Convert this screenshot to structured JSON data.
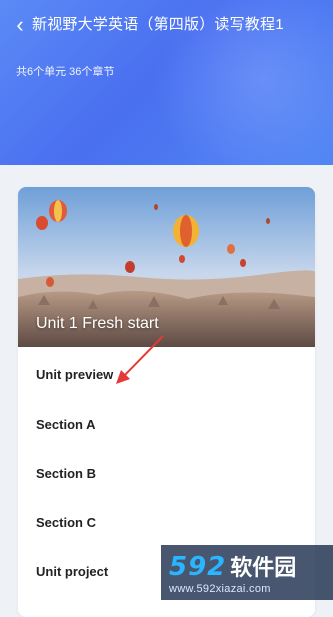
{
  "header": {
    "back_icon": "chevron-left-icon",
    "title": "新视野大学英语（第四版）读写教程1",
    "meta": "共6个单元 36个章节"
  },
  "unit": {
    "title": "Unit 1 Fresh start",
    "banner_image": "hot-air-balloons-landscape",
    "sections": [
      "Unit preview",
      "Section A",
      "Section B",
      "Section C",
      "Unit project"
    ]
  },
  "annotation": {
    "color": "#e53935",
    "icon": "red-arrow-annotation-icon"
  },
  "watermark": {
    "number": "592",
    "name": "软件园",
    "url": "www.592xiazai.com"
  }
}
